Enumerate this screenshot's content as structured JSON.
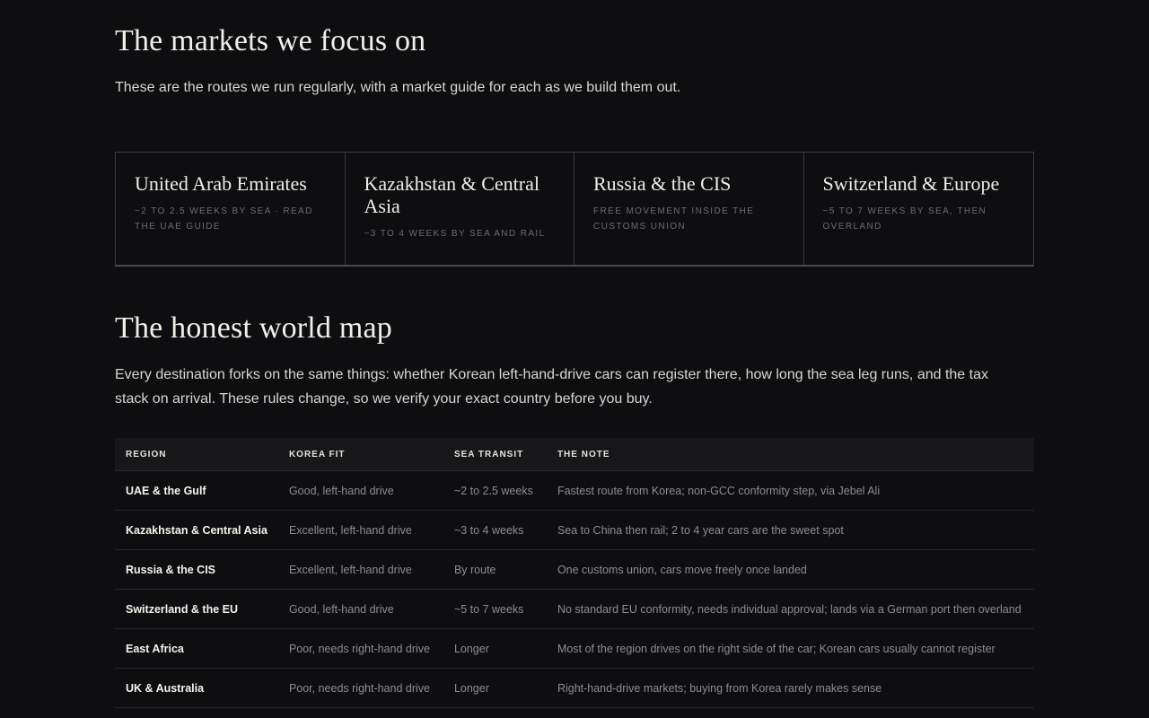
{
  "markets": {
    "heading": "The markets we focus on",
    "lede": "These are the routes we run regularly, with a market guide for each as we build them out.",
    "cards": [
      {
        "title": "United Arab Emirates",
        "sub": "~2 to 2.5 weeks by sea · Read the UAE guide"
      },
      {
        "title": "Kazakhstan & Central Asia",
        "sub": "~3 to 4 weeks by sea and rail"
      },
      {
        "title": "Russia & the CIS",
        "sub": "Free movement inside the customs union"
      },
      {
        "title": "Switzerland & Europe",
        "sub": "~5 to 7 weeks by sea, then overland"
      }
    ]
  },
  "map": {
    "heading": "The honest world map",
    "lede": "Every destination forks on the same things: whether Korean left-hand-drive cars can register there, how long the sea leg runs, and the tax stack on arrival. These rules change, so we verify your exact country before you buy.",
    "columns": [
      "REGION",
      "KOREA FIT",
      "SEA TRANSIT",
      "THE NOTE"
    ],
    "rows": [
      {
        "region": "UAE & the Gulf",
        "fit": "Good, left-hand drive",
        "transit": "~2 to 2.5 weeks",
        "note": "Fastest route from Korea; non-GCC conformity step, via Jebel Ali"
      },
      {
        "region": "Kazakhstan & Central Asia",
        "fit": "Excellent, left-hand drive",
        "transit": "~3 to 4 weeks",
        "note": "Sea to China then rail; 2 to 4 year cars are the sweet spot"
      },
      {
        "region": "Russia & the CIS",
        "fit": "Excellent, left-hand drive",
        "transit": "By route",
        "note": "One customs union, cars move freely once landed"
      },
      {
        "region": "Switzerland & the EU",
        "fit": "Good, left-hand drive",
        "transit": "~5 to 7 weeks",
        "note": "No standard EU conformity, needs individual approval; lands via a German port then overland"
      },
      {
        "region": "East Africa",
        "fit": "Poor, needs right-hand drive",
        "transit": "Longer",
        "note": "Most of the region drives on the right side of the car; Korean cars usually cannot register"
      },
      {
        "region": "UK & Australia",
        "fit": "Poor, needs right-hand drive",
        "transit": "Longer",
        "note": "Right-hand-drive markets; buying from Korea rarely makes sense"
      }
    ]
  }
}
